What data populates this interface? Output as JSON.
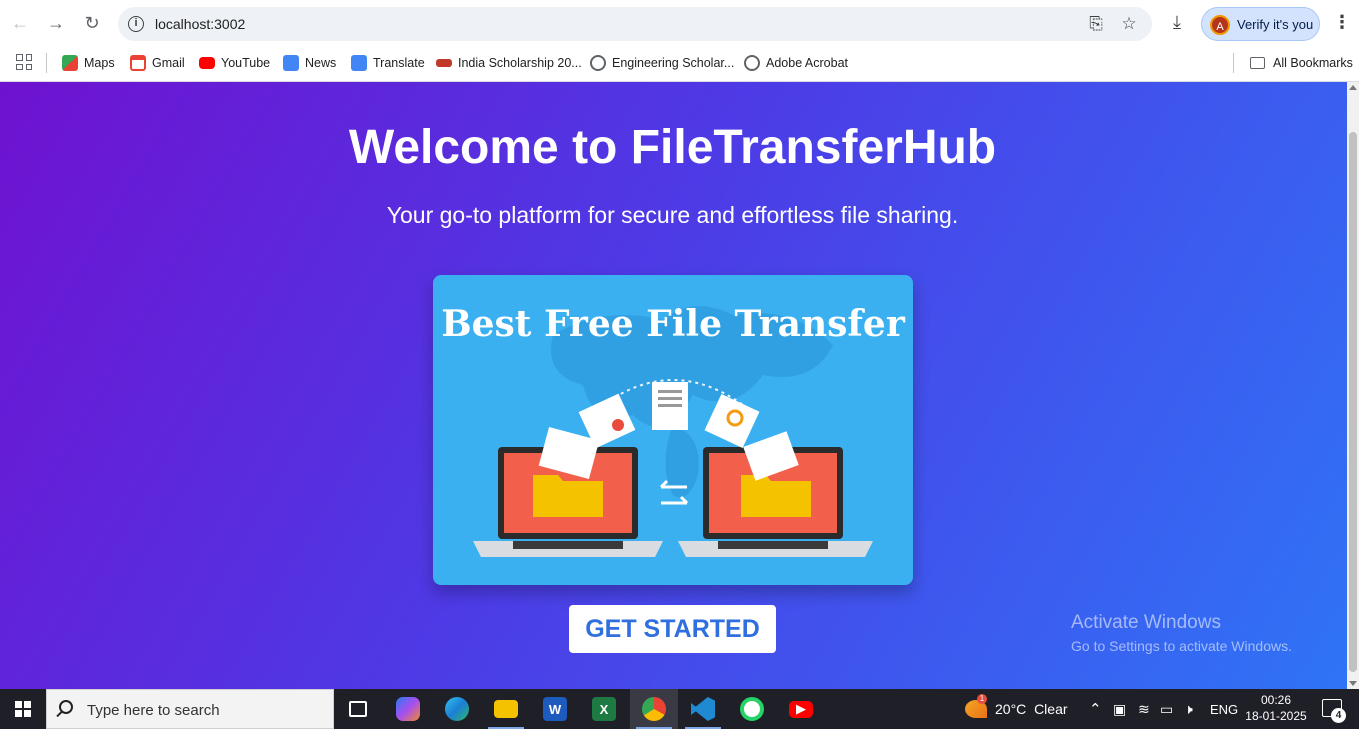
{
  "browser": {
    "url": "localhost:3002",
    "verify_label": "Verify it's you",
    "avatar_letter": "A",
    "bookmarks": [
      {
        "label": "Maps",
        "color": "#34a853"
      },
      {
        "label": "Gmail",
        "color": "#ea4335"
      },
      {
        "label": "YouTube",
        "color": "#ff0000"
      },
      {
        "label": "News",
        "color": "#4285f4"
      },
      {
        "label": "Translate",
        "color": "#4285f4"
      },
      {
        "label": "India Scholarship 20...",
        "color": "#c0392b"
      },
      {
        "label": "Engineering Scholar...",
        "color": "#5f6368"
      },
      {
        "label": "Adobe Acrobat",
        "color": "#5f6368"
      }
    ],
    "all_bookmarks_label": "All Bookmarks"
  },
  "page": {
    "title": "Welcome to FileTransferHub",
    "subtitle": "Your go-to platform for secure and effortless file sharing.",
    "hero_image_text": "Best Free File Transfer",
    "cta_label": "GET STARTED",
    "activate_title": "Activate Windows",
    "activate_sub": "Go to Settings to activate Windows."
  },
  "taskbar": {
    "search_placeholder": "Type here to search",
    "weather_temp": "20°C",
    "weather_text": "Clear",
    "weather_badge": "1",
    "language": "ENG",
    "time": "00:26",
    "date": "18-01-2025",
    "notification_count": "4"
  },
  "colors": {
    "gradient_start": "#6f12d0",
    "gradient_end": "#2f74f6",
    "cta_text": "#2f6fe0"
  }
}
